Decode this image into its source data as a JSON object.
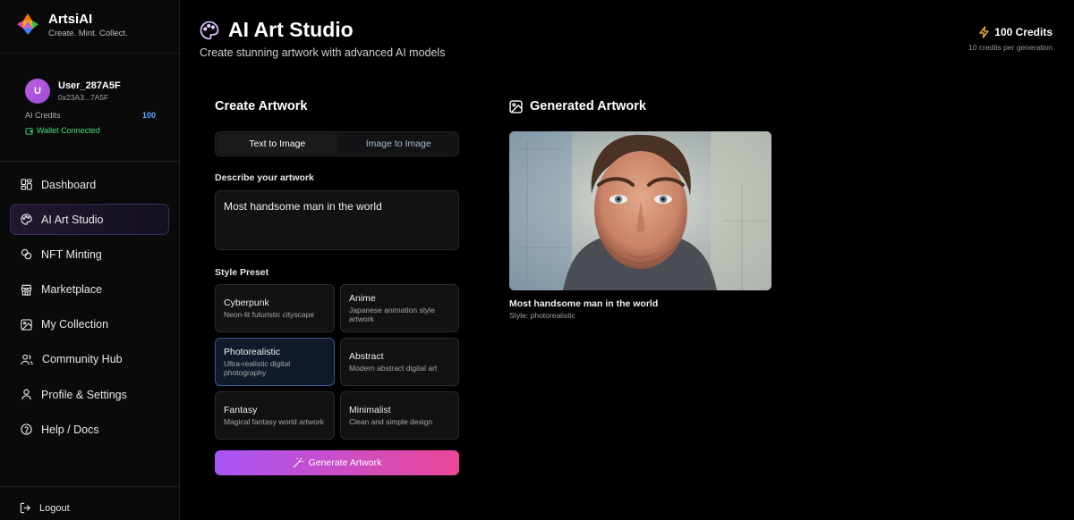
{
  "brand": {
    "name": "ArtsiAI",
    "tagline": "Create. Mint. Collect."
  },
  "user": {
    "initial": "U",
    "name": "User_287A5F",
    "address": "0x23A3...7A5F",
    "credits_label": "AI Credits",
    "credits_value": "100",
    "wallet_status": "Wallet Connected"
  },
  "nav": [
    {
      "label": "Dashboard",
      "icon": "dashboard-icon"
    },
    {
      "label": "AI Art Studio",
      "icon": "palette-icon",
      "active": true
    },
    {
      "label": "NFT Minting",
      "icon": "nft-icon"
    },
    {
      "label": "Marketplace",
      "icon": "store-icon"
    },
    {
      "label": "My Collection",
      "icon": "image-icon"
    },
    {
      "label": "Community Hub",
      "icon": "users-icon"
    },
    {
      "label": "Profile & Settings",
      "icon": "user-icon"
    },
    {
      "label": "Help / Docs",
      "icon": "help-icon"
    }
  ],
  "logout": "Logout",
  "header": {
    "title": "AI Art Studio",
    "subtitle": "Create stunning artwork with advanced AI models",
    "credits": "100 Credits",
    "credits_note": "10 credits per generation"
  },
  "create": {
    "heading": "Create Artwork",
    "tabs": [
      "Text to Image",
      "Image to Image"
    ],
    "prompt_label": "Describe your artwork",
    "prompt_value": "Most handsome man in the world",
    "style_label": "Style Preset",
    "styles": [
      {
        "title": "Cyberpunk",
        "desc": "Neon-lit futuristic cityscape"
      },
      {
        "title": "Anime",
        "desc": "Japanese animation style artwork"
      },
      {
        "title": "Photorealistic",
        "desc": "Ultra-realistic digital photography",
        "selected": true
      },
      {
        "title": "Abstract",
        "desc": "Modern abstract digital art"
      },
      {
        "title": "Fantasy",
        "desc": "Magical fantasy world artwork"
      },
      {
        "title": "Minimalist",
        "desc": "Clean and simple design"
      }
    ],
    "generate_label": "Generate Artwork"
  },
  "result": {
    "heading": "Generated Artwork",
    "caption": "Most handsome man in the world",
    "style": "Style: photorealistic"
  },
  "colors": {
    "accent_purple": "#a855f7",
    "accent_pink": "#ec4899",
    "credits_blue": "#60a5fa",
    "wallet_green": "#4ade80"
  }
}
